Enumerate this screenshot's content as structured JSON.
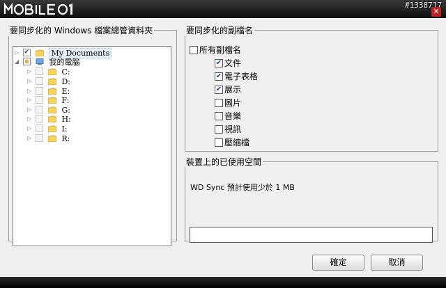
{
  "brand": {
    "logo_text": "MOBILE01",
    "watermark": "#1338717"
  },
  "window": {
    "close_glyph": "✕"
  },
  "folders_panel": {
    "legend": "要同步化的 Windows 檔案總管資料夾",
    "tree": [
      {
        "label": "My Documents",
        "checked": true,
        "expanded": false,
        "type": "folder",
        "selected": true
      },
      {
        "label": "我的電腦",
        "checked": "partial",
        "expanded": true,
        "type": "computer"
      },
      {
        "label": "C:",
        "checked": false,
        "type": "folder"
      },
      {
        "label": "D:",
        "checked": false,
        "type": "folder"
      },
      {
        "label": "E:",
        "checked": false,
        "type": "folder"
      },
      {
        "label": "F:",
        "checked": false,
        "type": "folder"
      },
      {
        "label": "G:",
        "checked": false,
        "type": "folder"
      },
      {
        "label": "H:",
        "checked": false,
        "type": "folder"
      },
      {
        "label": "I:",
        "checked": false,
        "type": "folder"
      },
      {
        "label": "R:",
        "checked": false,
        "type": "folder"
      }
    ]
  },
  "extensions_panel": {
    "legend": "要同步化的副檔名",
    "all": {
      "label": "所有副檔名",
      "checked": false
    },
    "items": [
      {
        "label": "文件",
        "checked": true
      },
      {
        "label": "電子表格",
        "checked": true
      },
      {
        "label": "展示",
        "checked": true
      },
      {
        "label": "圖片",
        "checked": false
      },
      {
        "label": "音樂",
        "checked": false
      },
      {
        "label": "視訊",
        "checked": false
      },
      {
        "label": "壓縮檔",
        "checked": false
      }
    ]
  },
  "space_panel": {
    "legend": "裝置上的已使用空間",
    "text": "WD Sync 預計使用少於  1 MB",
    "usage_fraction": 0
  },
  "buttons": {
    "ok": "確定",
    "cancel": "取消"
  },
  "icons": {
    "check": "✔",
    "collapsed": "▷",
    "expanded": "◢"
  }
}
